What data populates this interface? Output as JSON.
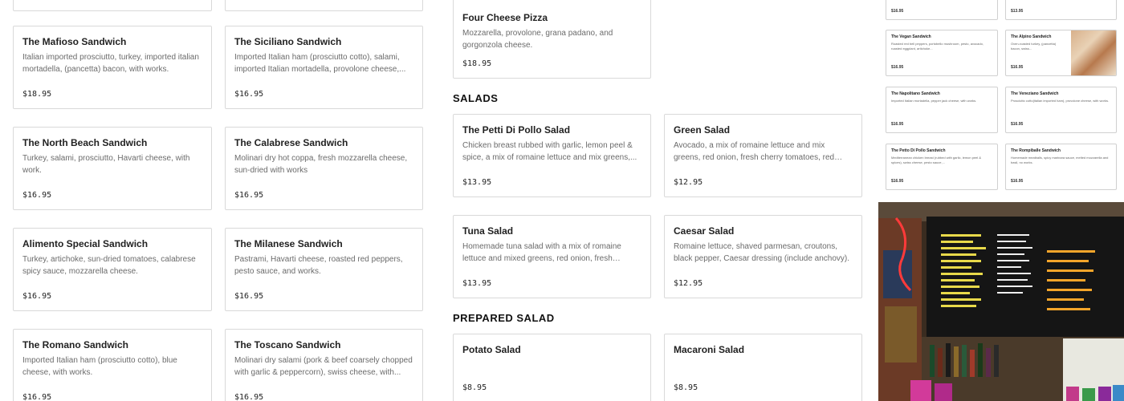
{
  "sandwiches_col1": [
    {
      "name": "",
      "desc": "",
      "price": ""
    },
    {
      "name": "The Mafioso Sandwich",
      "desc": "Italian imported prosciutto, turkey, imported italian mortadella, (pancetta) bacon, with works.",
      "price": "$18.95"
    },
    {
      "name": "The North Beach Sandwich",
      "desc": "Turkey, salami, prosciutto, Havarti cheese, with work.",
      "price": "$16.95"
    },
    {
      "name": "Alimento Special Sandwich",
      "desc": "Turkey, artichoke, sun-dried tomatoes, calabrese spicy sauce, mozzarella cheese.",
      "price": "$16.95"
    },
    {
      "name": "The Romano Sandwich",
      "desc": "Imported Italian ham (prosciutto cotto), blue cheese, with works.",
      "price": "$16.95"
    }
  ],
  "sandwiches_col2": [
    {
      "name": "",
      "desc": "",
      "price": ""
    },
    {
      "name": "The Siciliano Sandwich",
      "desc": "Imported Italian ham (prosciutto cotto), salami, imported Italian mortadella, provolone cheese,...",
      "price": "$16.95"
    },
    {
      "name": "The Calabrese Sandwich",
      "desc": "Molinari dry hot coppa, fresh mozzarella cheese, sun-dried with works",
      "price": "$16.95"
    },
    {
      "name": "The Milanese Sandwich",
      "desc": "Pastrami, Havarti cheese, roasted red peppers, pesto sauce, and works.",
      "price": "$16.95"
    },
    {
      "name": "The Toscano Sandwich",
      "desc": "Molinari dry salami (pork & beef coarsely chopped with garlic & peppercorn), swiss cheese, with...",
      "price": "$16.95"
    }
  ],
  "pizza": {
    "name": "Four Cheese Pizza",
    "desc": "Mozzarella, provolone, grana padano, and gorgonzola cheese.",
    "price": "$18.95"
  },
  "salads": {
    "title": "SALADS",
    "items": [
      {
        "name": "The Petti Di Pollo Salad",
        "desc": "Chicken breast rubbed with garlic, lemon peel & spice, a mix of romaine lettuce and mix greens,...",
        "price": "$13.95"
      },
      {
        "name": "Green Salad",
        "desc": "Avocado, a mix of romaine lettuce and mix greens, red onion, fresh cherry tomatoes, red cabbage,...",
        "price": "$12.95"
      },
      {
        "name": "Tuna Salad",
        "desc": "Homemade tuna salad with a mix of romaine lettuce and mixed greens, red onion, fresh cherry...",
        "price": "$13.95"
      },
      {
        "name": "Caesar Salad",
        "desc": "Romaine lettuce, shaved parmesan, croutons, black pepper, Caesar dressing (include anchovy).",
        "price": "$12.95"
      }
    ]
  },
  "prepared_salad": {
    "title": "PREPARED SALAD",
    "items": [
      {
        "name": "Potato Salad",
        "price": "$8.95"
      },
      {
        "name": "Macaroni Salad",
        "price": "$8.95"
      }
    ]
  },
  "mini_menu": [
    {
      "name": "",
      "desc": "",
      "price": "$16.95"
    },
    {
      "name": "",
      "desc": "",
      "price": "$13.95"
    },
    {
      "name": "The Vegan Sandwich",
      "desc": "Roasted red bell peppers, portobello mushroom, pesto, avocado, roasted eggplant, artichoke...",
      "price": "$16.95"
    },
    {
      "name": "The Alpino Sandwich",
      "desc": "Oven-roasted turkey, (pancetta) bacon, swiss...",
      "price": "$16.95"
    },
    {
      "name": "The Napolitano Sandwich",
      "desc": "Imported Italian mortadella, pepper jack cheese, with works.",
      "price": "$16.95"
    },
    {
      "name": "The Veneziano Sandwich",
      "desc": "Prosciutto cotto(italian imported ham), provolone cheese, with works.",
      "price": "$16.95"
    },
    {
      "name": "The Petto Di Pollo Sandwich",
      "desc": "Mediterranean chicken breast (rubbed with garlic, lemon peel & spices), swiss cheese, pesto sauce,...",
      "price": "$16.95"
    },
    {
      "name": "The Rompiballe Sandwich",
      "desc": "Homemade meatballs, spicy marinara sauce, melted mozzarella and basil, no works.",
      "price": "$16.95"
    }
  ],
  "colors": {
    "card_border": "#d9d9d9",
    "text": "#222222",
    "muted": "#6b6b6b"
  }
}
